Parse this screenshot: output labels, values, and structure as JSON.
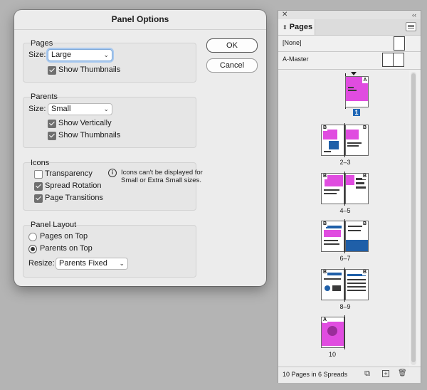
{
  "dialog": {
    "title": "Panel Options",
    "ok_label": "OK",
    "cancel_label": "Cancel",
    "pages": {
      "heading": "Pages",
      "size_label": "Size:",
      "size_value": "Large",
      "show_thumbnails_label": "Show Thumbnails",
      "show_thumbnails_checked": true
    },
    "parents": {
      "heading": "Parents",
      "size_label": "Size:",
      "size_value": "Small",
      "show_vertically_label": "Show Vertically",
      "show_vertically_checked": true,
      "show_thumbnails_label": "Show Thumbnails",
      "show_thumbnails_checked": true
    },
    "icons": {
      "heading": "Icons",
      "transparency_label": "Transparency",
      "transparency_checked": false,
      "spread_rotation_label": "Spread Rotation",
      "spread_rotation_checked": true,
      "page_transitions_label": "Page Transitions",
      "page_transitions_checked": true,
      "note": "Icons can't be displayed for Small or Extra Small sizes."
    },
    "panel_layout": {
      "heading": "Panel Layout",
      "pages_on_top_label": "Pages on Top",
      "parents_on_top_label": "Parents on Top",
      "selected": "Parents on Top",
      "resize_label": "Resize:",
      "resize_value": "Parents Fixed"
    }
  },
  "pages_panel": {
    "tab_label": "Pages",
    "masters": [
      {
        "name": "[None]"
      },
      {
        "name": "A-Master"
      }
    ],
    "spreads": [
      {
        "label": "1",
        "selected": true,
        "master_letters": [
          "A"
        ]
      },
      {
        "label": "2–3",
        "selected": false,
        "master_letters": [
          "B",
          "B"
        ]
      },
      {
        "label": "4–5",
        "selected": false,
        "master_letters": [
          "B",
          "B"
        ]
      },
      {
        "label": "6–7",
        "selected": false,
        "master_letters": [
          "B",
          "B"
        ]
      },
      {
        "label": "8–9",
        "selected": false,
        "master_letters": [
          "B",
          "B"
        ]
      },
      {
        "label": "10",
        "selected": false,
        "master_letters": [
          "A"
        ]
      }
    ],
    "footer_text": "10 Pages in 6 Spreads",
    "icons": [
      "close-icon",
      "collapse-icon",
      "panel-menu-icon",
      "edit-page-size-icon",
      "new-page-icon",
      "trash-icon"
    ],
    "colors": {
      "selection": "#1f67b6",
      "magenta": "#e04ce0"
    }
  }
}
